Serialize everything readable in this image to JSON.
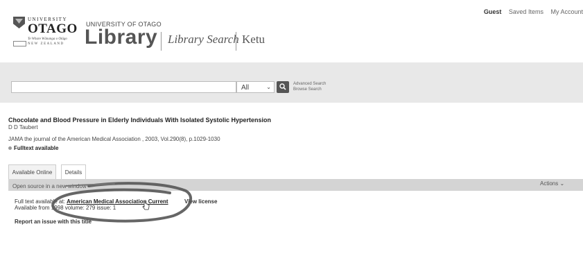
{
  "top_nav": {
    "guest": "Guest",
    "saved_items": "Saved Items",
    "my_account": "My Account"
  },
  "logo": {
    "university": "UNIVERSITY",
    "of": "of",
    "otago": "OTAGO",
    "maori_motto": "Te Whare Wānanga o Otāgo",
    "country": "NEW ZEALAND"
  },
  "branding": {
    "small": "UNIVERSITY OF OTAGO",
    "library": "Library",
    "library_search": "Library Search",
    "ketu": "Ketu"
  },
  "search": {
    "query": "",
    "scope": "All",
    "advanced": "Advanced Search",
    "browse": "Browse Search"
  },
  "record": {
    "title": "Chocolate and Blood Pressure in Elderly Individuals With Isolated Systolic Hypertension",
    "author": "D D Taubert",
    "source": "JAMA the journal of the American Medical Association , 2003, Vol.290(8), p.1029-1030",
    "availability": "Fulltext available"
  },
  "tabs": [
    {
      "label": "Available Online",
      "active": true
    },
    {
      "label": "Details",
      "active": false
    }
  ],
  "panel": {
    "open_source": "Open source in a new window",
    "actions": "Actions",
    "fulltext_prefix": "Full text available at:",
    "fulltext_link": "American Medical Association Current",
    "view_license": "View license",
    "coverage": "Available from 1998 volume: 279 issue: 1",
    "report": "Report an issue with this title"
  },
  "colors": {
    "search_band": "#e8e8e8",
    "panel_header": "#d4d4d4",
    "highlight_ring": "#555555"
  }
}
